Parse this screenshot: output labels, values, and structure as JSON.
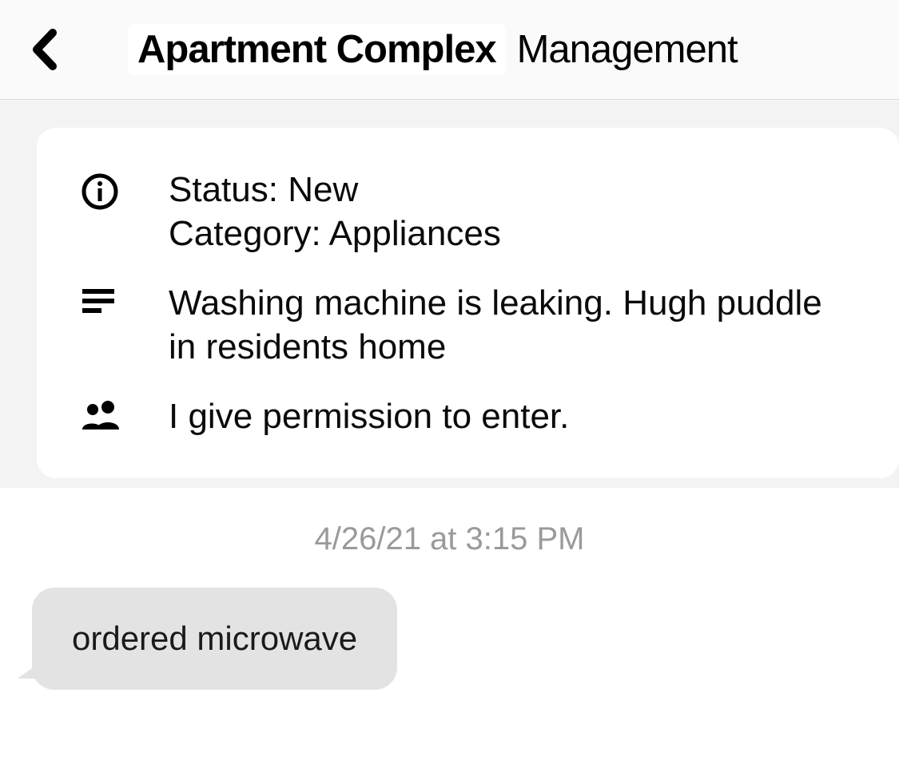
{
  "header": {
    "title_bold": "Apartment Complex",
    "title_light": "Management"
  },
  "card": {
    "status_label": "Status:",
    "status_value": "New",
    "category_label": "Category:",
    "category_value": "Appliances",
    "description": "Washing machine is leaking. Hugh puddle in residents home",
    "permission": "I give permission to enter."
  },
  "timestamp": "4/26/21 at 3:15 PM",
  "message": "ordered microwave"
}
